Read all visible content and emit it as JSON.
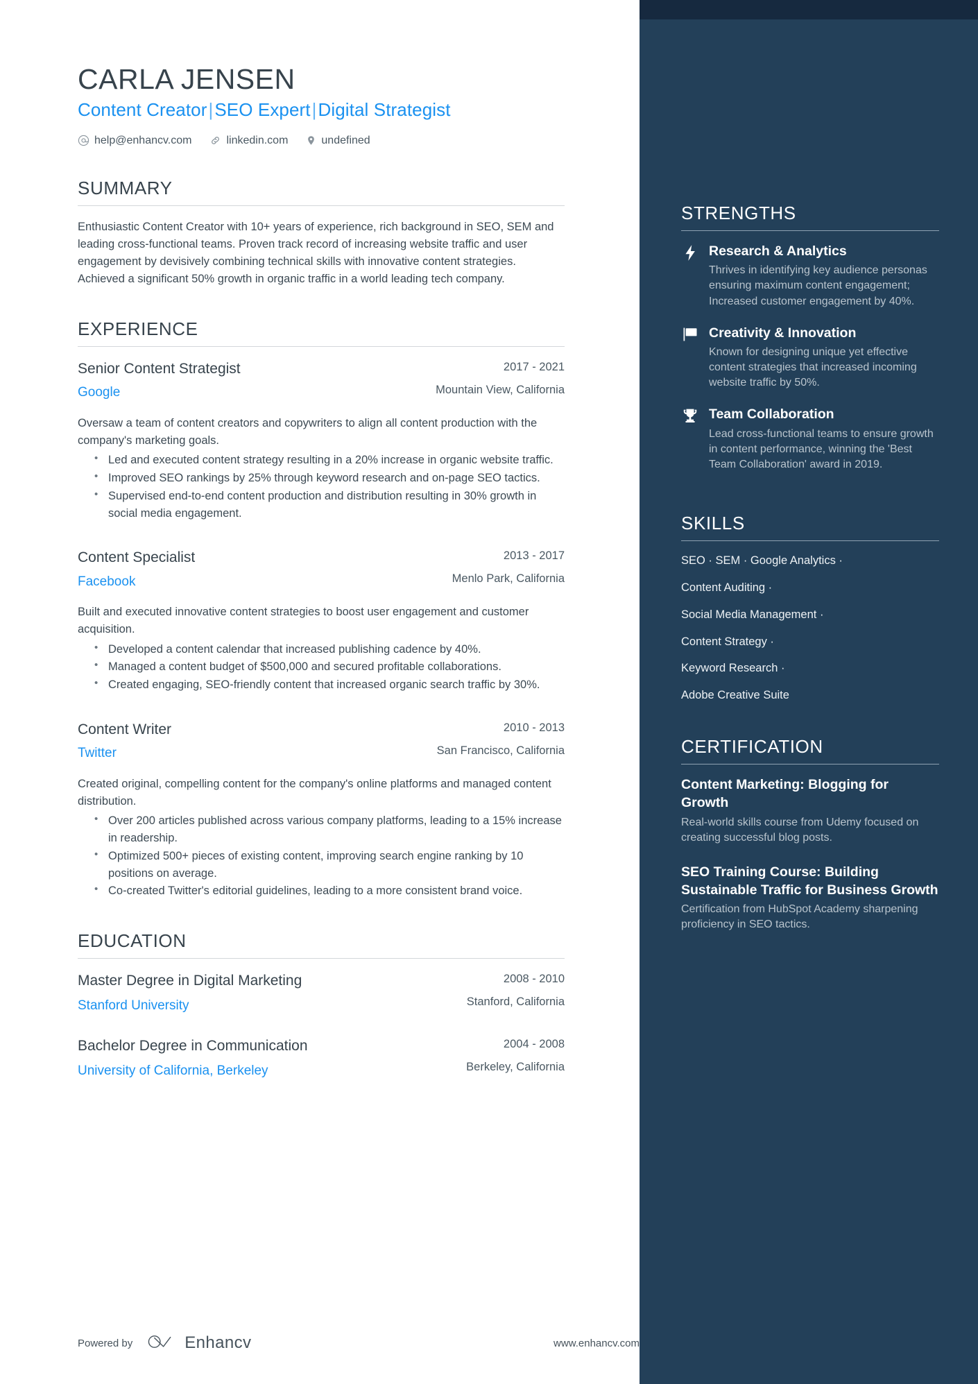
{
  "header": {
    "name": "CARLA JENSEN",
    "headline_parts": [
      "Content Creator",
      "SEO Expert",
      "Digital Strategist"
    ],
    "separator": "|",
    "contacts": [
      {
        "icon": "email-icon",
        "text": "help@enhancv.com"
      },
      {
        "icon": "link-icon",
        "text": "linkedin.com"
      },
      {
        "icon": "location-pin-icon",
        "text": "undefined"
      }
    ]
  },
  "summary": {
    "title": "SUMMARY",
    "text": "Enthusiastic Content Creator with 10+ years of experience, rich background in SEO, SEM and leading cross-functional teams. Proven track record of increasing website traffic and user engagement by devisively combining technical skills with innovative content strategies. Achieved a significant 50% growth in organic traffic in a world leading tech company."
  },
  "experience": {
    "title": "EXPERIENCE",
    "entries": [
      {
        "role": "Senior Content Strategist",
        "company": "Google",
        "dates": "2017 - 2021",
        "location": "Mountain View, California",
        "description": "Oversaw a team of content creators and copywriters to align all content production with the company's marketing goals.",
        "bullets": [
          "Led and executed content strategy resulting in a 20% increase in organic website traffic.",
          "Improved SEO rankings by 25% through keyword research and on-page SEO tactics.",
          "Supervised end-to-end content production and distribution resulting in 30% growth in social media engagement."
        ]
      },
      {
        "role": "Content Specialist",
        "company": "Facebook",
        "dates": "2013 - 2017",
        "location": "Menlo Park, California",
        "description": "Built and executed innovative content strategies to boost user engagement and customer acquisition.",
        "bullets": [
          "Developed a content calendar that increased publishing cadence by 40%.",
          "Managed a content budget of $500,000 and secured profitable collaborations.",
          "Created engaging, SEO-friendly content that increased organic search traffic by 30%."
        ]
      },
      {
        "role": "Content Writer",
        "company": "Twitter",
        "dates": "2010 - 2013",
        "location": "San Francisco, California",
        "description": "Created original, compelling content for the company's online platforms and managed content distribution.",
        "bullets": [
          "Over 200 articles published across various company platforms, leading to a 15% increase in readership.",
          "Optimized 500+ pieces of existing content, improving search engine ranking by 10 positions on average.",
          "Co-created Twitter's editorial guidelines, leading to a more consistent brand voice."
        ]
      }
    ]
  },
  "education": {
    "title": "EDUCATION",
    "entries": [
      {
        "degree": "Master Degree in Digital Marketing",
        "school": "Stanford University",
        "dates": "2008 - 2010",
        "location": "Stanford, California"
      },
      {
        "degree": "Bachelor Degree in Communication",
        "school": "University of California, Berkeley",
        "dates": "2004 - 2008",
        "location": "Berkeley, California"
      }
    ]
  },
  "strengths": {
    "title": "STRENGTHS",
    "items": [
      {
        "icon": "lightning-bolt-icon",
        "title": "Research & Analytics",
        "description": "Thrives in identifying key audience personas ensuring maximum content engagement; Increased customer engagement by 40%."
      },
      {
        "icon": "flag-icon",
        "title": "Creativity & Innovation",
        "description": "Known for designing unique yet effective content strategies that increased incoming website traffic by 50%."
      },
      {
        "icon": "trophy-icon",
        "title": "Team Collaboration",
        "description": "Lead cross-functional teams to ensure growth in content performance, winning the 'Best Team Collaboration' award in 2019."
      }
    ]
  },
  "skills": {
    "title": "SKILLS",
    "lines": [
      "SEO · SEM · Google Analytics ·",
      "Content Auditing ·",
      "Social Media Management ·",
      "Content Strategy ·",
      "Keyword Research ·",
      "Adobe Creative Suite"
    ]
  },
  "certification": {
    "title": "CERTIFICATION",
    "items": [
      {
        "title": "Content Marketing: Blogging for Growth",
        "description": "Real-world skills course from Udemy focused on creating successful blog posts."
      },
      {
        "title": "SEO Training Course: Building Sustainable Traffic for Business Growth",
        "description": "Certification from HubSpot Academy sharpening proficiency in SEO tactics."
      }
    ]
  },
  "footer": {
    "powered_by": "Powered by",
    "brand": "Enhancv",
    "url": "www.enhancv.com"
  },
  "colors": {
    "accent_blue": "#1a91f0",
    "sidebar_bg": "#234059",
    "sidebar_top_strip": "#16293f",
    "heading_text": "#37434c",
    "body_text": "#3d4a54",
    "sidebar_muted": "#b9c4cd"
  }
}
